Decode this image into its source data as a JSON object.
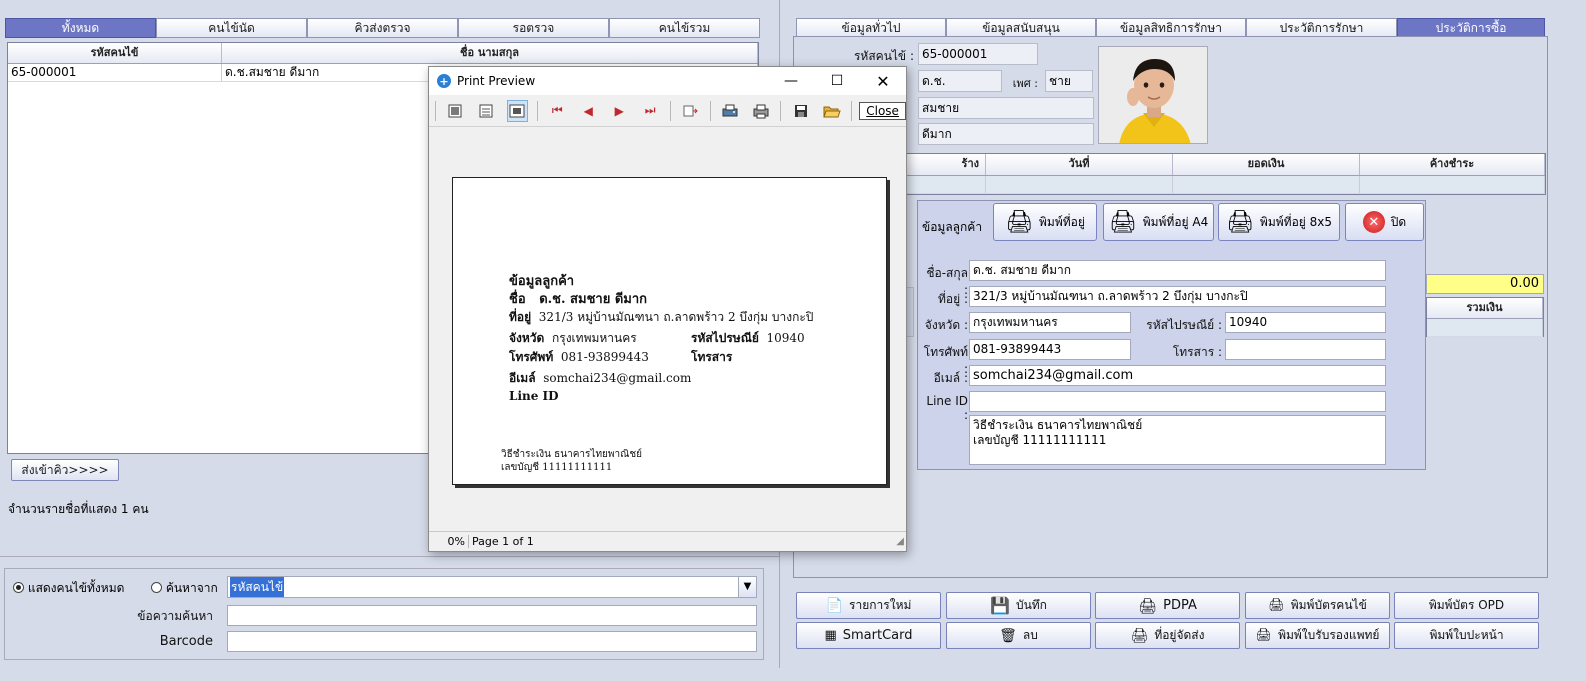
{
  "left": {
    "tabs": [
      "ทั้งหมด",
      "คนไข้นัด",
      "คิวส่งตรวจ",
      "รอตรวจ",
      "คนไข้รวม"
    ],
    "grid": {
      "columns": [
        "รหัสคนไข้",
        "ชื่อ นามสกุล"
      ],
      "rows": [
        [
          "65-000001",
          "ด.ช.สมชาย ดีมาก"
        ]
      ]
    },
    "send_queue_button": "ส่งเข้าคิว>>>>",
    "count_text": "จำนวนรายชื่อที่แสดง 1 คน",
    "search": {
      "radio_all": "แสดงคนไข้ทั้งหมด",
      "radio_search": "ค้นหาจาก",
      "search_by_value": "รหัสคนไข้",
      "text_label": "ข้อความค้นหา",
      "barcode_label": "Barcode"
    }
  },
  "right": {
    "tabs": [
      "ข้อมูลทั่วไป",
      "ข้อมูลสนับสนุน",
      "ข้อมูลสิทธิการรักษา",
      "ประวัติการรักษา",
      "ประวัติการซื้อ"
    ],
    "patient_id_label": "รหัสคนไข้ :",
    "patient_id": "65-000001",
    "prefix": "ด.ช.",
    "sex_label": "เพศ :",
    "sex": "ชาย",
    "first_name": "สมชาย",
    "last_name": "ดีมาก",
    "history_columns": [
      "ร้าง",
      "วันที่",
      "ยอดเงิน",
      "ค้างชำระ"
    ],
    "total_value": "0.00",
    "total_label": "รวมเงิน",
    "buttons": [
      "รายการใหม่",
      "บันทึก",
      "PDPA",
      "พิมพ์บัตรคนไข้",
      "พิมพ์บัตร OPD",
      "SmartCard",
      "ลบ",
      "ที่อยู่จัดส่ง",
      "พิมพ์ใบรับรองแพทย์",
      "พิมพ์ใบปะหน้า"
    ]
  },
  "popup": {
    "title": "ข้อมูลลูกค้า",
    "btn_print": "พิมพ์ที่อยู่",
    "btn_print_a4": "พิมพ์ที่อยู่ A4",
    "btn_print_8x5": "พิมพ์ที่อยู่ 8x5",
    "btn_close": "ปิด",
    "labels": {
      "name": "ชื่อ-สกุล :",
      "address": "ที่อยู่ :",
      "province": "จังหวัด :",
      "postcode": "รหัสไปรษณีย์ :",
      "phone": "โทรศัพท์ :",
      "fax": "โทรสาร :",
      "email": "อีเมล์ :",
      "line": "Line ID :"
    },
    "values": {
      "name": "ด.ช. สมชาย  ดีมาก",
      "address": "321/3 หมู่บ้านมัณฑนา ถ.ลาดพร้าว 2   บึงกุ่ม บางกะปิ",
      "province": "กรุงเทพมหานคร",
      "postcode": "10940",
      "phone": "081-93899443",
      "fax": "",
      "email": "somchai234@gmail.com",
      "line": "",
      "note_line1": "วิธีชำระเงิน ธนาคารไทยพาณิชย์",
      "note_line2": "เลขบัญชี 11111111111"
    }
  },
  "preview": {
    "title": "Print Preview",
    "close_label": "Close",
    "status_zoom": "0%",
    "status_page": "Page 1 of 1",
    "doc": {
      "heading": "ข้อมูลลูกค้า",
      "name_label": "ชื่อ",
      "name": "ด.ช. สมชาย  ดีมาก",
      "address_label": "ที่อยู่",
      "address": "321/3 หมู่บ้านมัณฑนา ถ.ลาดพร้าว 2   บึงกุ่ม บางกะปิ",
      "province_label": "จังหวัด",
      "province": "กรุงเทพมหานคร",
      "postcode_label": "รหัสไปรษณีย์",
      "postcode": "10940",
      "phone_label": "โทรศัพท์",
      "phone": "081-93899443",
      "fax_label": "โทรสาร",
      "email_label": "อีเมล์",
      "email": "somchai234@gmail.com",
      "line_label": "Line ID",
      "note_line1": "วิธีชำระเงิน ธนาคารไทยพาณิชย์",
      "note_line2": "เลขบัญชี 11111111111"
    }
  },
  "colors": {
    "active_tab": "#6d76c4",
    "total_bg": "#ffff88",
    "grid_selected": "#dfe8f0"
  }
}
